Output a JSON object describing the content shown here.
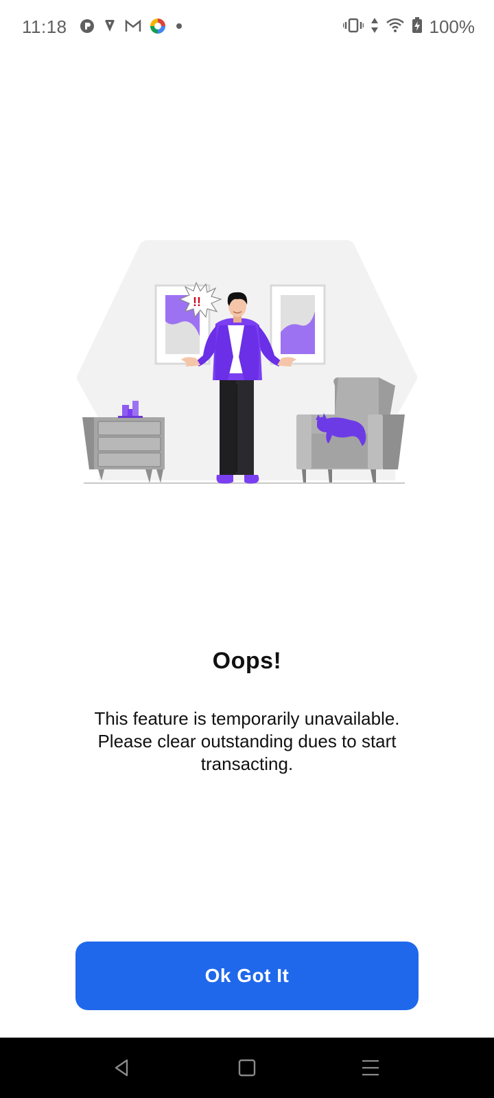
{
  "status_bar": {
    "time": "11:18",
    "battery": "100%",
    "left_icons": [
      "app-icon",
      "vpn-icon",
      "gmail-icon",
      "colorful-app-icon",
      "notification-dot-icon"
    ],
    "right_icons": [
      "vibrate-icon",
      "data-arrows-icon",
      "wifi-icon",
      "battery-charging-icon"
    ]
  },
  "dialog": {
    "title": "Oops!",
    "message": "This feature is temporarily unavailable. Please clear outstanding dues to start transacting.",
    "button_label": "Ok Got It"
  },
  "colors": {
    "accent": "#1f68eb",
    "illustration_purple": "#7b3ff2",
    "background": "#ffffff",
    "nav_bar": "#000000"
  },
  "nav_bar": {
    "buttons": [
      "back-icon",
      "home-icon",
      "recents-icon"
    ]
  }
}
